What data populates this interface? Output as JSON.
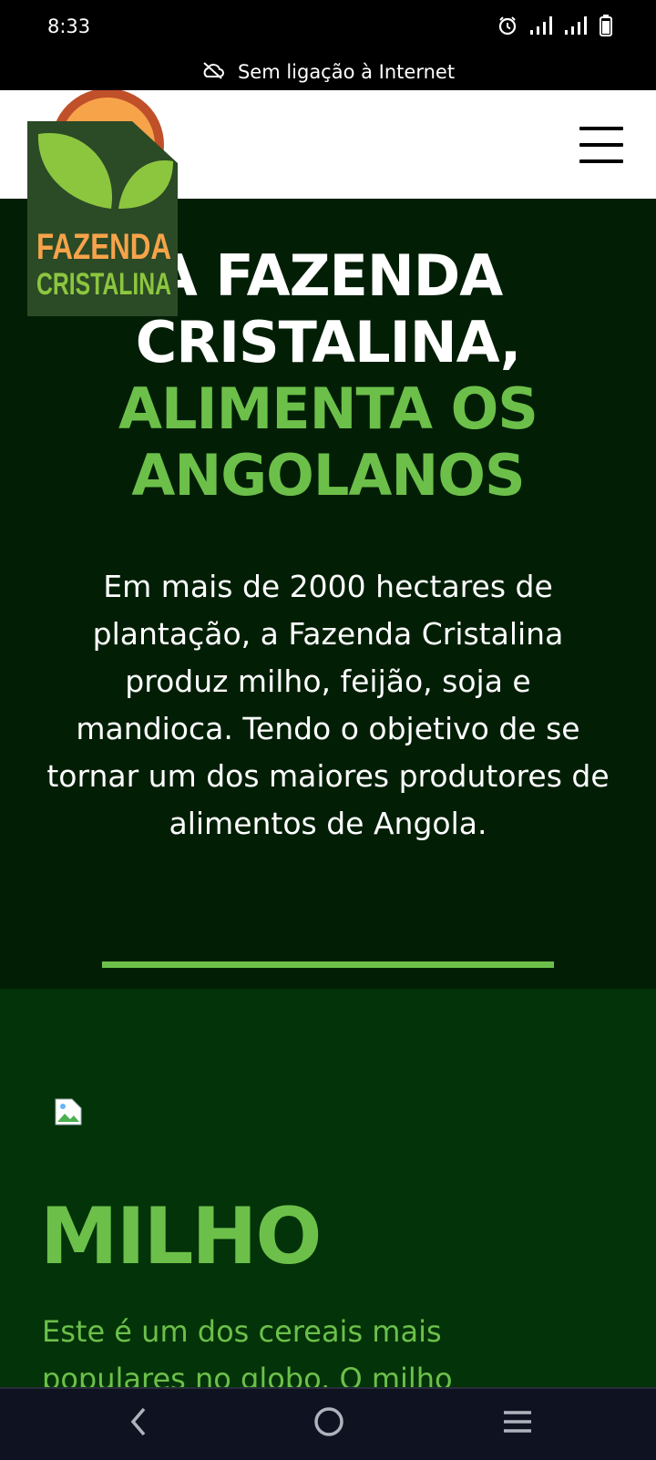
{
  "status_bar": {
    "time": "8:33",
    "icons": [
      "alarm-icon",
      "signal-icon",
      "signal-icon",
      "battery-icon"
    ]
  },
  "offline_banner": {
    "icon": "cloud-off-icon",
    "text": "Sem ligação à Internet"
  },
  "header": {
    "logo_line1": "FAZENDA",
    "logo_line2": "CRISTALINA",
    "menu_icon": "hamburger-menu-icon"
  },
  "hero": {
    "title_line1": "A FAZENDA",
    "title_line2": "CRISTALINA,",
    "title_line3": "ALIMENTA OS",
    "title_line4": "ANGOLANOS",
    "description": "Em mais de 2000 hectares de plantação, a Fazenda Cristalina produz milho, feijão, soja e mandioca. Tendo o objetivo de se tornar um dos maiores produtores de alimentos de Angola."
  },
  "product": {
    "image_icon": "broken-image-icon",
    "title": "MILHO",
    "text": "Este é um dos cereais mais populares no globo. O milho"
  },
  "nav_bar": {
    "back_icon": "back-icon",
    "home_icon": "home-icon",
    "recents_icon": "recents-menu-icon"
  },
  "colors": {
    "hero_bg": "#021f06",
    "section_bg": "#033308",
    "accent_green": "#6cc04a",
    "logo_orange": "#f7a34a",
    "logo_dark": "#2b4a26"
  }
}
